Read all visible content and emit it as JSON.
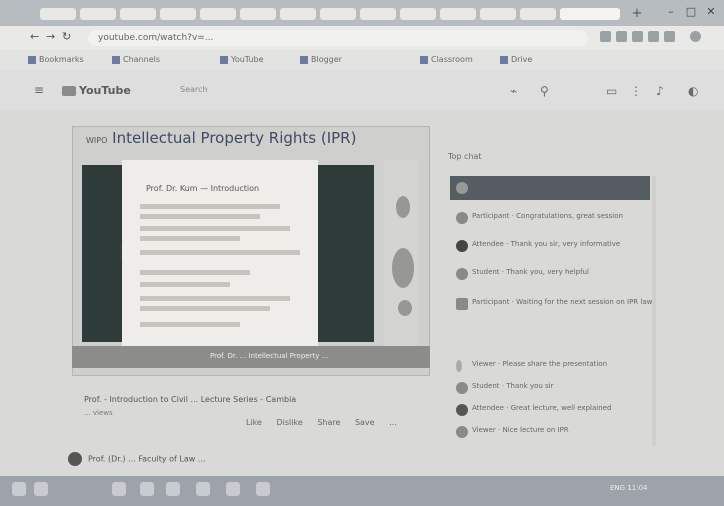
{
  "browser": {
    "tabs_count": 14,
    "new_tab_symbol": "+",
    "address": "youtube.com/watch?v=...",
    "window_buttons": [
      "–",
      "□",
      "✕"
    ]
  },
  "bookmarks": [
    "Bookmarks",
    "Channels",
    "YouTube",
    "Blogger",
    "Classroom",
    "Drive"
  ],
  "header": {
    "logo_text": "YouTube",
    "search_placeholder": "Search",
    "icons": [
      "menu-icon",
      "mic-icon",
      "create-icon",
      "apps-icon",
      "bell-icon"
    ]
  },
  "video": {
    "title_prefix": "WIPO",
    "title": "Intellectual Property Rights (IPR)",
    "slide_heading": "Prof. Dr. Kum — Introduction",
    "caption": "Prof. Dr. ... Intellectual Property ...",
    "meta_title": "Prof. - Introduction to Civil ... Lecture Series - Cambia",
    "views": "... views",
    "actions": [
      "Like",
      "Dislike",
      "Share",
      "Save",
      "..."
    ]
  },
  "channel": {
    "name": "Prof. (Dr.) ... Faculty of Law ..."
  },
  "chat": {
    "header": "Top chat",
    "messages": [
      "Participant · Congratulations, great session",
      "Attendee · Thank you sir, very informative",
      "Student · Thank you, very helpful",
      "Participant · Waiting for the next session on IPR law",
      "Viewer · Please share the presentation",
      "Student · Thank you sir",
      "Attendee · Great lecture, well explained",
      "Viewer · Nice lecture on IPR"
    ]
  },
  "taskbar": {
    "tray_text": "ENG 11:04"
  }
}
